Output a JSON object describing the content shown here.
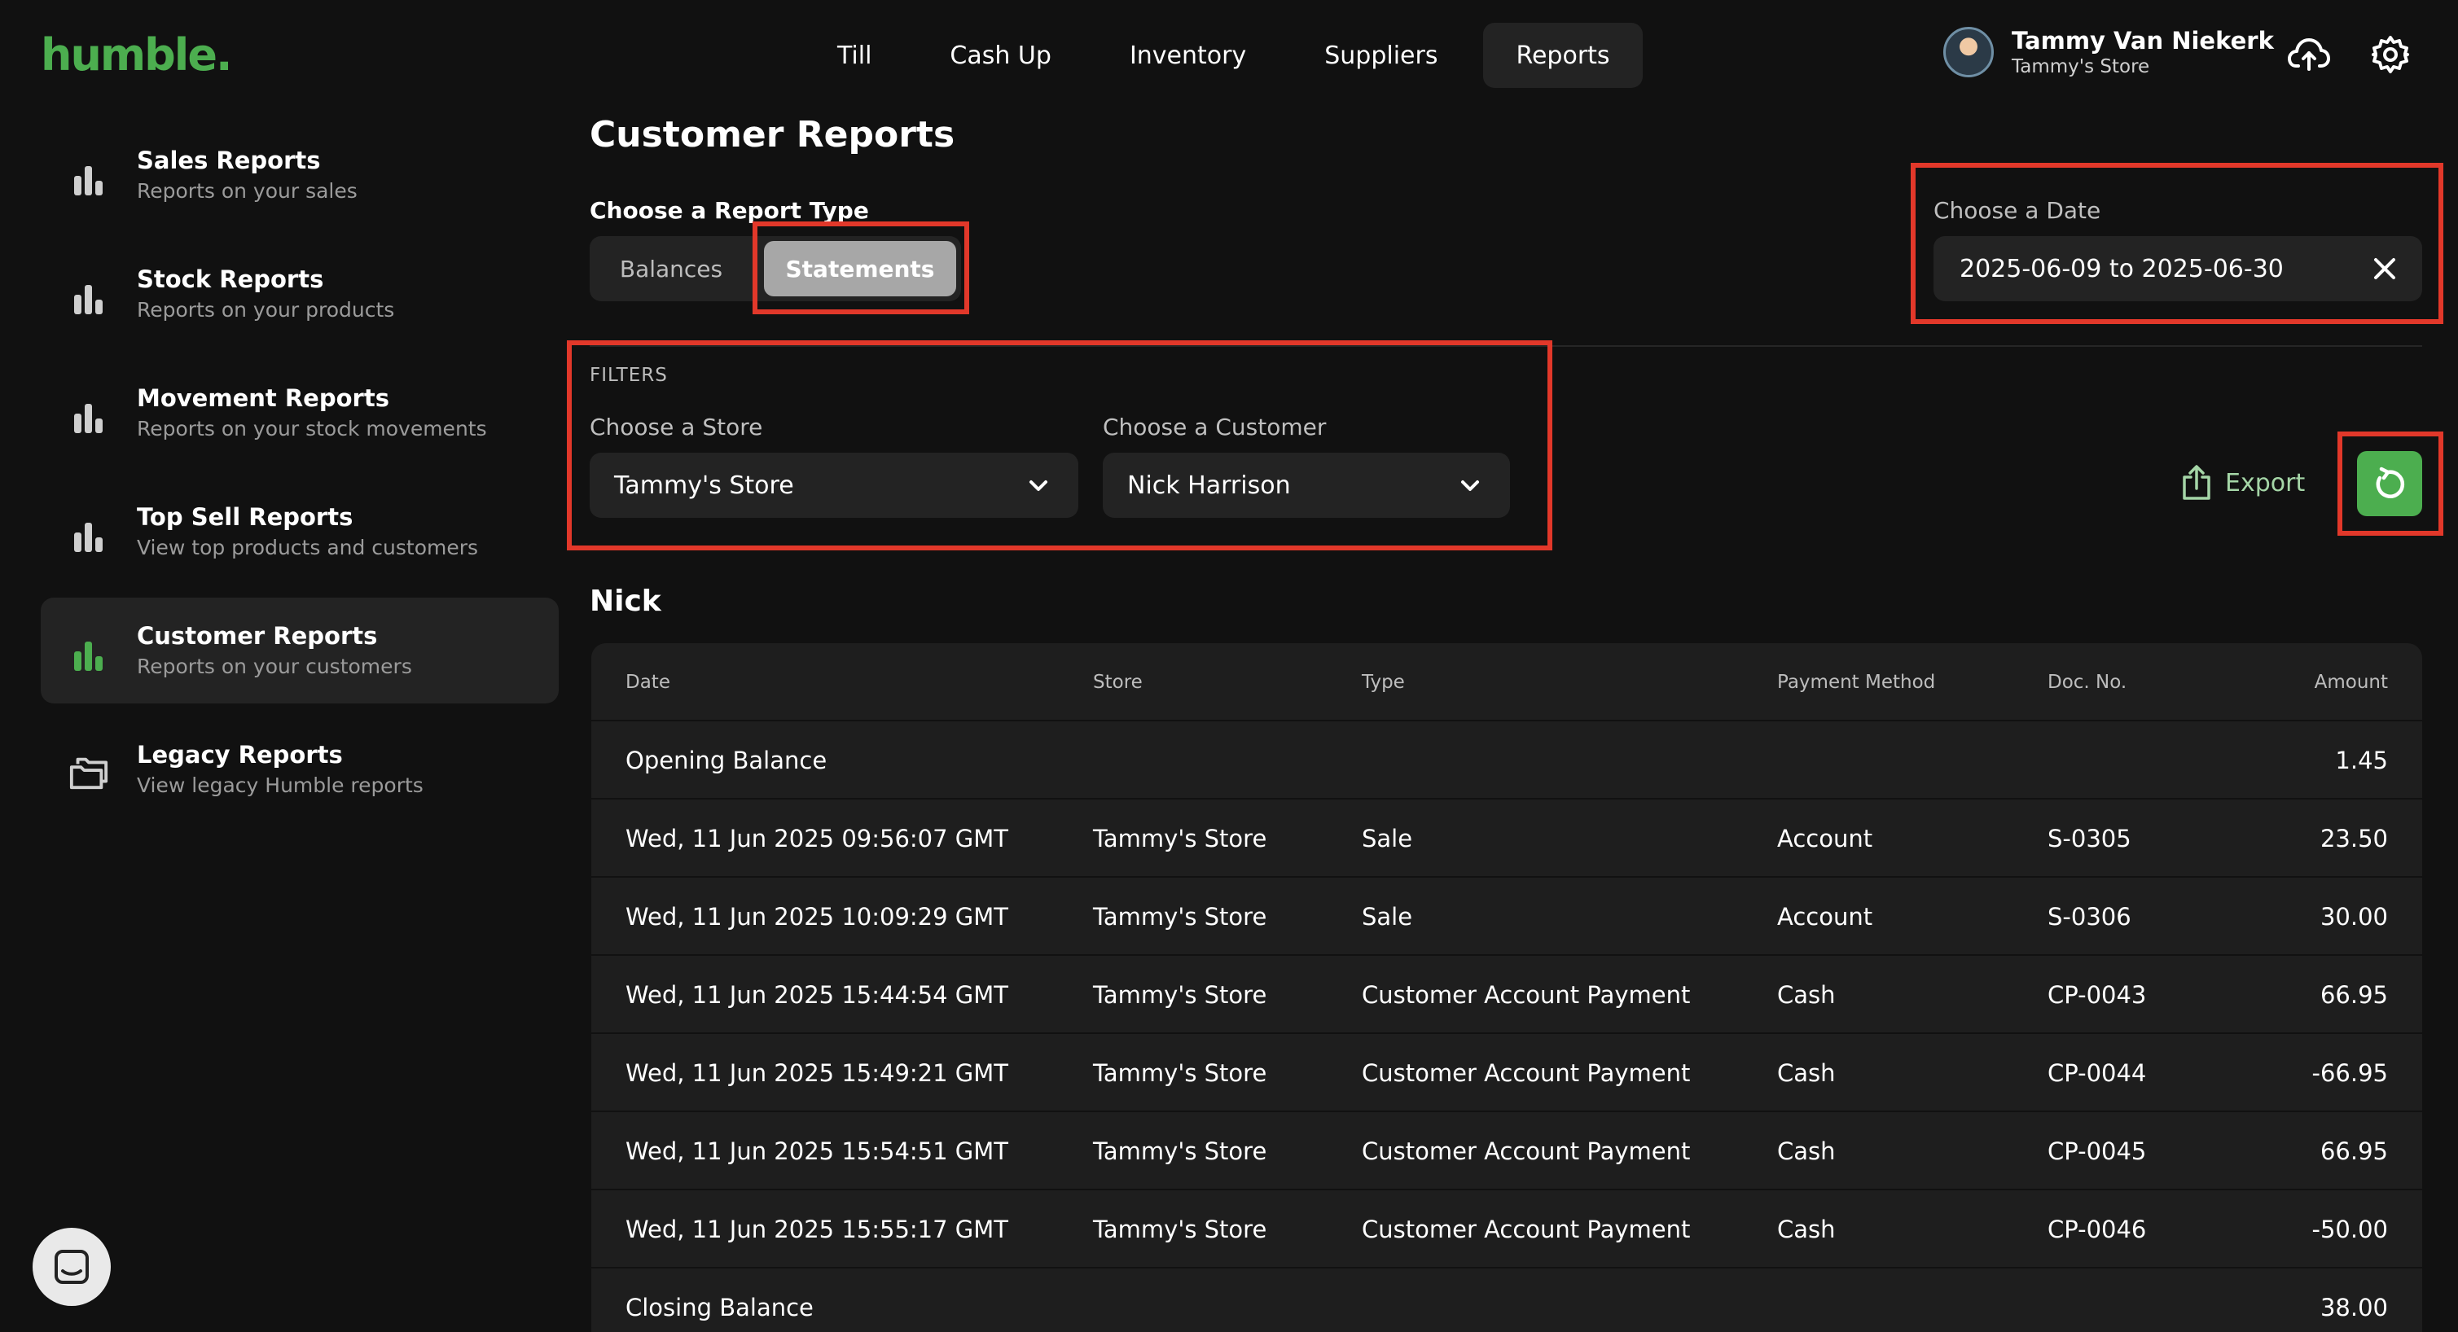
{
  "app": {
    "logo": "humble."
  },
  "nav": {
    "items": [
      {
        "label": "Till"
      },
      {
        "label": "Cash Up"
      },
      {
        "label": "Inventory"
      },
      {
        "label": "Suppliers"
      },
      {
        "label": "Reports",
        "active": true
      }
    ]
  },
  "user": {
    "name": "Tammy Van Niekerk",
    "store": "Tammy's Store"
  },
  "sidebar": {
    "items": [
      {
        "title": "Sales Reports",
        "subtitle": "Reports on your sales",
        "icon": "bar-chart-icon"
      },
      {
        "title": "Stock Reports",
        "subtitle": "Reports on your products",
        "icon": "bar-chart-icon"
      },
      {
        "title": "Movement Reports",
        "subtitle": "Reports on your stock movements",
        "icon": "bar-chart-icon"
      },
      {
        "title": "Top Sell Reports",
        "subtitle": "View top products and customers",
        "icon": "bar-chart-icon"
      },
      {
        "title": "Customer Reports",
        "subtitle": "Reports on your customers",
        "icon": "bar-chart-icon",
        "active": true
      },
      {
        "title": "Legacy Reports",
        "subtitle": "View legacy Humble reports",
        "icon": "folders-icon"
      }
    ]
  },
  "main": {
    "title": "Customer Reports",
    "report_type": {
      "label": "Choose a Report Type",
      "options": [
        {
          "label": "Balances"
        },
        {
          "label": "Statements",
          "active": true
        }
      ]
    },
    "date": {
      "label": "Choose a Date",
      "value": "2025-06-09 to 2025-06-30"
    },
    "filters": {
      "heading": "FILTERS",
      "store": {
        "label": "Choose a Store",
        "value": "Tammy's Store"
      },
      "customer": {
        "label": "Choose a Customer",
        "value": "Nick Harrison"
      }
    },
    "export_label": "Export",
    "customer_name": "Nick",
    "table": {
      "headers": {
        "date": "Date",
        "store": "Store",
        "type": "Type",
        "payment": "Payment Method",
        "doc": "Doc. No.",
        "amount": "Amount"
      },
      "rows": [
        {
          "date": "Opening Balance",
          "store": "",
          "type": "",
          "payment": "",
          "doc": "",
          "amount": "1.45"
        },
        {
          "date": "Wed, 11 Jun 2025 09:56:07 GMT",
          "store": "Tammy's Store",
          "type": "Sale",
          "payment": "Account",
          "doc": "S-0305",
          "amount": "23.50"
        },
        {
          "date": "Wed, 11 Jun 2025 10:09:29 GMT",
          "store": "Tammy's Store",
          "type": "Sale",
          "payment": "Account",
          "doc": "S-0306",
          "amount": "30.00"
        },
        {
          "date": "Wed, 11 Jun 2025 15:44:54 GMT",
          "store": "Tammy's Store",
          "type": "Customer Account Payment",
          "payment": "Cash",
          "doc": "CP-0043",
          "amount": "66.95"
        },
        {
          "date": "Wed, 11 Jun 2025 15:49:21 GMT",
          "store": "Tammy's Store",
          "type": "Customer Account Payment",
          "payment": "Cash",
          "doc": "CP-0044",
          "amount": "-66.95"
        },
        {
          "date": "Wed, 11 Jun 2025 15:54:51 GMT",
          "store": "Tammy's Store",
          "type": "Customer Account Payment",
          "payment": "Cash",
          "doc": "CP-0045",
          "amount": "66.95"
        },
        {
          "date": "Wed, 11 Jun 2025 15:55:17 GMT",
          "store": "Tammy's Store",
          "type": "Customer Account Payment",
          "payment": "Cash",
          "doc": "CP-0046",
          "amount": "-50.00"
        },
        {
          "date": "Closing Balance",
          "store": "",
          "type": "",
          "payment": "",
          "doc": "",
          "amount": "38.00"
        }
      ]
    }
  },
  "colors": {
    "brand": "#4cae4f",
    "highlight": "#e2382a",
    "background": "#111111",
    "panel": "#232323"
  }
}
